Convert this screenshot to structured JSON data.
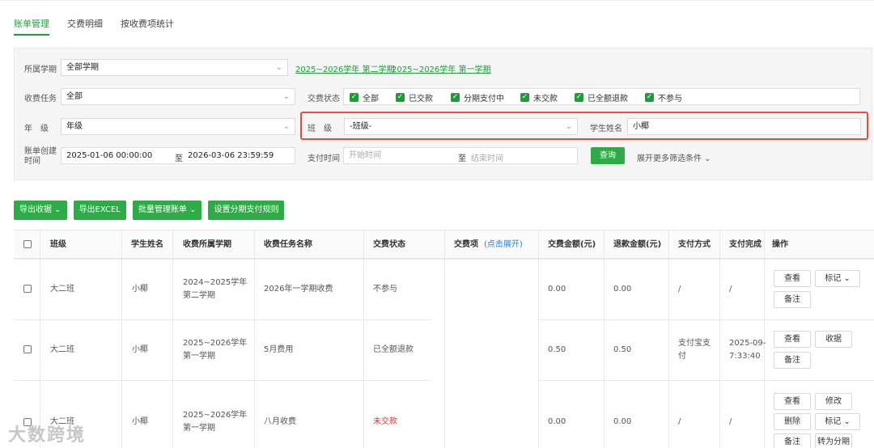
{
  "tabs": [
    "账单管理",
    "交费明细",
    "按收费项统计"
  ],
  "filter": {
    "term_label": "所属学期",
    "term_value": "全部学期",
    "term_links": [
      "2025~2026学年 第二学期",
      "2025~2026学年 第一学期"
    ],
    "task_label": "收费任务",
    "task_value": "全部",
    "status_label": "交费状态",
    "status_options": [
      "全部",
      "已交款",
      "分期支付中",
      "未交款",
      "已全额退款",
      "不参与"
    ],
    "grade_label": "年　级",
    "grade_value": "年级",
    "class_label": "班　级",
    "class_value": "-班级-",
    "student_label": "学生姓名",
    "student_value": "小椰",
    "created_label_1": "账单创建",
    "created_label_2": "时间",
    "created_start": "2025-01-06 00:00:00",
    "to": "至",
    "created_end": "2026-03-06 23:59:59",
    "paytime_label": "支付时间",
    "pay_start_ph": "开始时间",
    "pay_end_ph": "结束时间",
    "query": "查询",
    "more": "展开更多筛选条件 ⌄"
  },
  "toolbar": [
    "导出收据 ⌄",
    "导出EXCEL",
    "批量管理账单 ⌄",
    "设置分期支付规则"
  ],
  "table": {
    "headers": [
      "班级",
      "学生姓名",
      "收费所属学期",
      "收费任务名称",
      "交费状态",
      "交费项",
      "交费金额(元)",
      "退款金额(元)",
      "支付方式",
      "支付完成",
      "操作"
    ],
    "expand_hint": "(点击展开)",
    "rows": [
      {
        "cls": "大二班",
        "name": "小椰",
        "term1": "2024~2025学年",
        "term2": "第二学期",
        "task": "2026年一学期收费",
        "status": "不参与",
        "paid": "0.00",
        "refund": "0.00",
        "method": "/",
        "time1": "/",
        "time2": "",
        "ops": [
          "查看",
          "标记 ⌄",
          "备注"
        ]
      },
      {
        "cls": "大二班",
        "name": "小椰",
        "term1": "2025~2026学年",
        "term2": "第一学期",
        "task": "5月费用",
        "status": "已全额退款",
        "paid": "0.50",
        "refund": "0.50",
        "method1": "支付宝支",
        "method2": "付",
        "time1": "2025-09-",
        "time2": "7:33:40",
        "ops": [
          "查看",
          "收据",
          "备注"
        ]
      },
      {
        "cls": "大二班",
        "name": "小椰",
        "term1": "2025~2026学年",
        "term2": "第一学期",
        "task": "八月收费",
        "status": "未交款",
        "paid": "0.00",
        "refund": "0.00",
        "method": "/",
        "time1": "/",
        "time2": "",
        "ops": [
          "查看",
          "修改",
          "删除",
          "标记 ⌄",
          "备注",
          "转为分期"
        ]
      }
    ]
  },
  "watermark": "大数跨境",
  "colors": {
    "accent": "#2eaa46",
    "alert": "#e74c3c",
    "unpaid": "#e03030"
  }
}
